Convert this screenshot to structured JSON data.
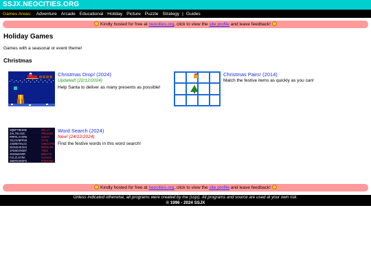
{
  "site": {
    "title": "SSJX.NEOCITIES.ORG"
  },
  "nav": {
    "areas_label": "Games Areas:",
    "items": [
      "Adventure",
      "Arcade",
      "Educational",
      "Holiday",
      "Picture",
      "Puzzle",
      "Strategy"
    ],
    "separator": "|",
    "guides": "Guides"
  },
  "notice": {
    "prefix": "Kindly hosted for free at ",
    "host_link": "neocities.org",
    "middle": ", click to view the ",
    "profile_link": "site profile",
    "suffix": " and leave feedback!"
  },
  "page": {
    "title": "Holiday Games",
    "description": "Games with a seasonal or event theme!",
    "section": "Christmas"
  },
  "games": [
    {
      "title": "Christmas Drop! (2024)",
      "status": "Updated! (22/12/2024)",
      "description": "Help Santa to deliver as many presents as possible!"
    },
    {
      "title": "Christmas Pairs! (2014)",
      "status": "",
      "description": "Match the festive items as quickly as you can!"
    },
    {
      "title": "Word Search (2024)",
      "status": "New! (24/12/2024)",
      "description": "Find the festive words in this word search!"
    }
  ],
  "wordsearch": {
    "grid_rows": [
      "UQNPTREEME",
      "ZALTBLSZC",
      "PRPOLAYZMH",
      "YDJAVNPPSR",
      "ISDRETRLGI",
      "SKSUSAEIES",
      "IPUDDIMGBT",
      "XEOGWCHOM",
      "FZLZLETRA",
      "SBKPUVRSPS"
    ],
    "word_list": [
      "HOLLY",
      "PRESENT",
      "SANTA",
      "STAR",
      "CHRISTMAS",
      "RUDOLPH",
      "TREE",
      "WREATH",
      "SLEIGH",
      "PUDDING"
    ]
  },
  "footer": {
    "disclaimer": "Unless indicated otherwise, all programs were created by me (ssjx). All programs and source are used at your own risk.",
    "copyright": "© 1996 - 2024 SSJX"
  },
  "colors": {
    "header_bg": "#00cfd0",
    "nav_bg": "#000000",
    "nav_label": "#ffd800",
    "notice_bg": "#ff9a9a",
    "link": "#1a2bd8",
    "updated": "#1a9a1a",
    "new": "#e00000"
  }
}
